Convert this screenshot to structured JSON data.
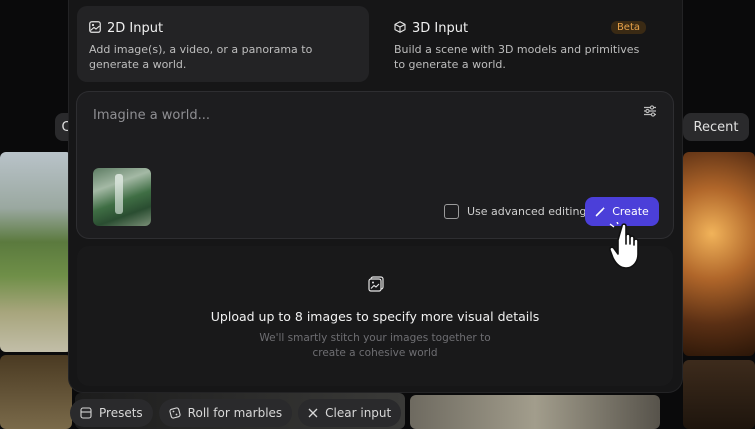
{
  "modes": [
    {
      "title": "2D Input",
      "description": "Add image(s), a video, or a panorama to generate a world.",
      "icon": "image-icon"
    },
    {
      "title": "3D Input",
      "description": "Build a scene with 3D models and primitives to generate a world.",
      "badge": "Beta",
      "icon": "cube-icon"
    }
  ],
  "prompt": {
    "placeholder": "Imagine a world...",
    "value": ""
  },
  "advanced_editing": {
    "label": "Use advanced editing",
    "checked": false
  },
  "create_button": {
    "label": "Create"
  },
  "upload": {
    "title": "Upload up to 8 images to specify more visual details",
    "subtitle": "We'll smartly stitch your images together to create a cohesive world"
  },
  "side": {
    "recent": "Recent",
    "left": "C"
  },
  "bottom_actions": [
    {
      "label": "Presets",
      "icon": "presets-icon"
    },
    {
      "label": "Roll for marbles",
      "icon": "dice-icon"
    },
    {
      "label": "Clear input",
      "icon": "close-icon"
    }
  ],
  "colors": {
    "accent": "#4b3fd9",
    "beta": "#e7a24a"
  }
}
